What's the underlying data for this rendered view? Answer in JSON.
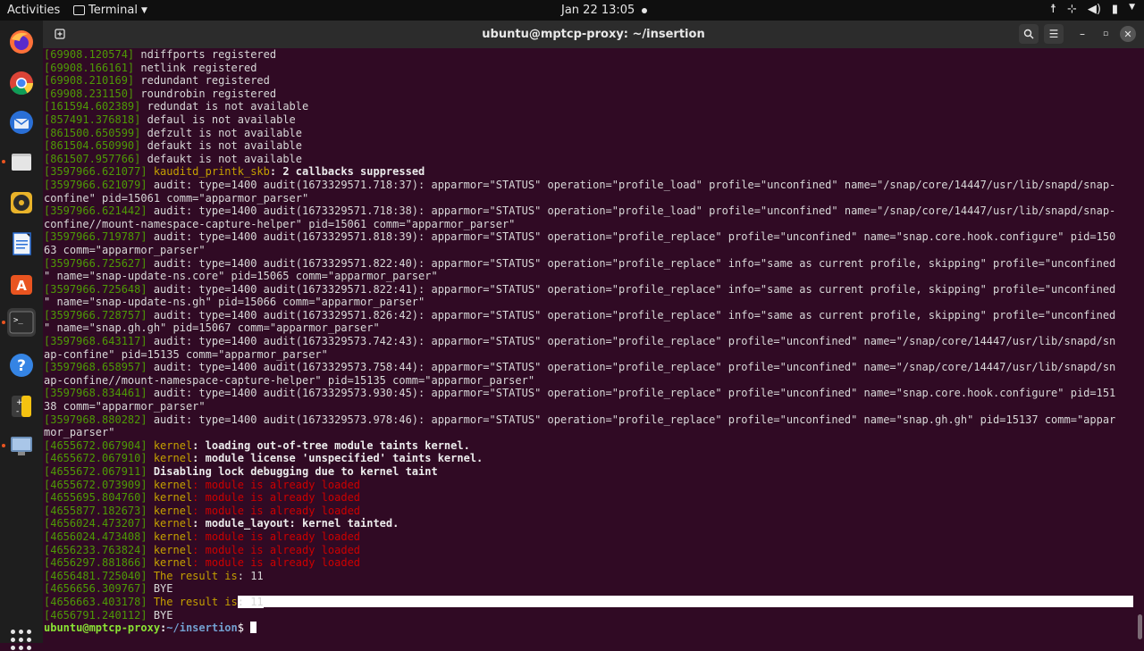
{
  "topbar": {
    "activities": "Activities",
    "app_menu": "Terminal",
    "clock": "Jan 22  13:05"
  },
  "dock": {
    "items": [
      "firefox-icon",
      "chrome-icon",
      "thunderbird-icon",
      "files-icon",
      "rhythmbox-icon",
      "libreoffice-writer-icon",
      "software-icon",
      "terminal-icon",
      "help-icon",
      "calculator-icon",
      "screenshot-icon"
    ]
  },
  "window": {
    "title": "ubuntu@mptcp-proxy: ~/insertion"
  },
  "terminal": {
    "lines": [
      {
        "ts": "[69908.120574]",
        "plain": " ndiffports registered"
      },
      {
        "ts": "[69908.166161]",
        "plain": " netlink registered"
      },
      {
        "ts": "[69908.210169]",
        "plain": " redundant registered"
      },
      {
        "ts": "[69908.231150]",
        "plain": " roundrobin registered"
      },
      {
        "ts": "[161594.602389]",
        "plain": " redundat is not available"
      },
      {
        "ts": "[857491.376818]",
        "plain": " defaul is not available"
      },
      {
        "ts": "[861500.650599]",
        "plain": " defzult is not available"
      },
      {
        "ts": "[861504.650990]",
        "plain": " defaukt is not available"
      },
      {
        "ts": "[861507.957766]",
        "plain": " defaukt is not available"
      },
      {
        "ts": "[3597966.621077]",
        "kern": " kauditd_printk_skb",
        "bold": ": 2 callbacks suppressed"
      },
      {
        "ts": "[3597966.621079]",
        "plain": " audit: type=1400 audit(1673329571.718:37): apparmor=\"STATUS\" operation=\"profile_load\" profile=\"unconfined\" name=\"/snap/core/14447/usr/lib/snapd/snap-"
      },
      {
        "plain": "confine\" pid=15061 comm=\"apparmor_parser\""
      },
      {
        "ts": "[3597966.621442]",
        "plain": " audit: type=1400 audit(1673329571.718:38): apparmor=\"STATUS\" operation=\"profile_load\" profile=\"unconfined\" name=\"/snap/core/14447/usr/lib/snapd/snap-"
      },
      {
        "plain": "confine//mount-namespace-capture-helper\" pid=15061 comm=\"apparmor_parser\""
      },
      {
        "ts": "[3597966.719787]",
        "plain": " audit: type=1400 audit(1673329571.818:39): apparmor=\"STATUS\" operation=\"profile_replace\" profile=\"unconfined\" name=\"snap.core.hook.configure\" pid=150"
      },
      {
        "plain": "63 comm=\"apparmor_parser\""
      },
      {
        "ts": "[3597966.725627]",
        "plain": " audit: type=1400 audit(1673329571.822:40): apparmor=\"STATUS\" operation=\"profile_replace\" info=\"same as current profile, skipping\" profile=\"unconfined"
      },
      {
        "plain": "\" name=\"snap-update-ns.core\" pid=15065 comm=\"apparmor_parser\""
      },
      {
        "ts": "[3597966.725648]",
        "plain": " audit: type=1400 audit(1673329571.822:41): apparmor=\"STATUS\" operation=\"profile_replace\" info=\"same as current profile, skipping\" profile=\"unconfined"
      },
      {
        "plain": "\" name=\"snap-update-ns.gh\" pid=15066 comm=\"apparmor_parser\""
      },
      {
        "ts": "[3597966.728757]",
        "plain": " audit: type=1400 audit(1673329571.826:42): apparmor=\"STATUS\" operation=\"profile_replace\" info=\"same as current profile, skipping\" profile=\"unconfined"
      },
      {
        "plain": "\" name=\"snap.gh.gh\" pid=15067 comm=\"apparmor_parser\""
      },
      {
        "ts": "[3597968.643117]",
        "plain": " audit: type=1400 audit(1673329573.742:43): apparmor=\"STATUS\" operation=\"profile_replace\" profile=\"unconfined\" name=\"/snap/core/14447/usr/lib/snapd/sn"
      },
      {
        "plain": "ap-confine\" pid=15135 comm=\"apparmor_parser\""
      },
      {
        "ts": "[3597968.658957]",
        "plain": " audit: type=1400 audit(1673329573.758:44): apparmor=\"STATUS\" operation=\"profile_replace\" profile=\"unconfined\" name=\"/snap/core/14447/usr/lib/snapd/sn"
      },
      {
        "plain": "ap-confine//mount-namespace-capture-helper\" pid=15135 comm=\"apparmor_parser\""
      },
      {
        "ts": "[3597968.834461]",
        "plain": " audit: type=1400 audit(1673329573.930:45): apparmor=\"STATUS\" operation=\"profile_replace\" profile=\"unconfined\" name=\"snap.core.hook.configure\" pid=151"
      },
      {
        "plain": "38 comm=\"apparmor_parser\""
      },
      {
        "ts": "[3597968.880282]",
        "plain": " audit: type=1400 audit(1673329573.978:46): apparmor=\"STATUS\" operation=\"profile_replace\" profile=\"unconfined\" name=\"snap.gh.gh\" pid=15137 comm=\"appar"
      },
      {
        "plain": "mor_parser\""
      },
      {
        "ts": "[4655672.067904]",
        "kern": " kernel",
        "bold": ": loading out-of-tree module taints kernel."
      },
      {
        "ts": "[4655672.067910]",
        "kern": " kernel",
        "bold": ": module license 'unspecified' taints kernel."
      },
      {
        "ts": "[4655672.067911]",
        "bold": " Disabling lock debugging due to kernel taint"
      },
      {
        "ts": "[4655672.073909]",
        "kern": " kernel",
        "red": ": module is already loaded"
      },
      {
        "ts": "[4655695.804760]",
        "kern": " kernel",
        "red": ": module is already loaded"
      },
      {
        "ts": "[4655877.182673]",
        "kern": " kernel",
        "red": ": module is already loaded"
      },
      {
        "ts": "[4656024.473207]",
        "kern": " kernel",
        "bold": ": module_layout: kernel tainted."
      },
      {
        "ts": "[4656024.473408]",
        "kern": " kernel",
        "red": ": module is already loaded"
      },
      {
        "ts": "[4656233.763824]",
        "kern": " kernel",
        "red": ": module is already loaded"
      },
      {
        "ts": "[4656297.881866]",
        "kern": " kernel",
        "red": ": module is already loaded"
      },
      {
        "ts": "[4656481.725040]",
        "kern": " The result is",
        "plain": ": 11"
      },
      {
        "ts": "[4656656.309767]",
        "plain": " BYE"
      },
      {
        "ts": "[4656663.403178]",
        "kern": " The result is",
        "hl": ": 11",
        "highlight": true
      },
      {
        "ts": "[4656791.240112]",
        "plain": " BYE"
      }
    ],
    "prompt": {
      "user_host": "ubuntu@mptcp-proxy",
      "colon": ":",
      "path": "~/insertion",
      "symbol": "$ "
    }
  },
  "colors": {
    "terminal_bg": "#300a24",
    "timestamp": "#4e9a06",
    "kernel_label": "#c4a000",
    "error_text": "#cc0000",
    "prompt_user": "#8ae234",
    "prompt_path": "#729fcf"
  }
}
